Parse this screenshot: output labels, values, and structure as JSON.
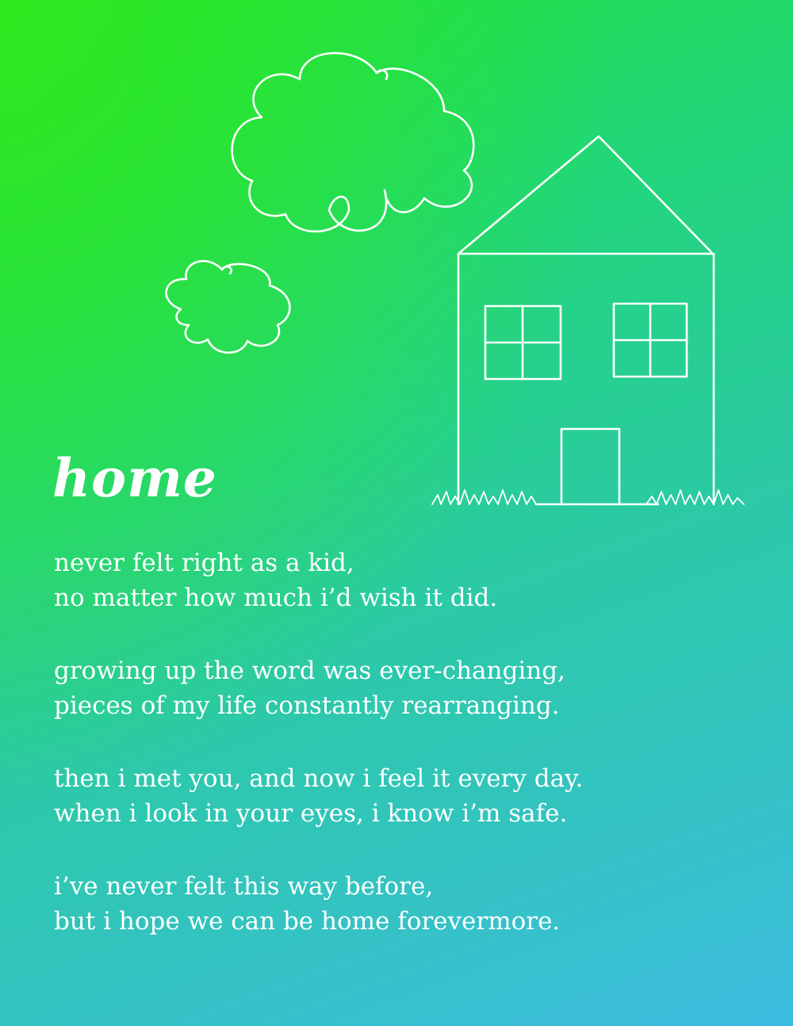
{
  "title": "home",
  "poem": {
    "stanzas": [
      {
        "lines": [
          "never felt right as a kid,",
          "no matter how much i’d wish it did."
        ]
      },
      {
        "lines": [
          "growing up the word was ever-changing,",
          "pieces of my life constantly rearranging."
        ]
      },
      {
        "lines": [
          "then i met you, and now i feel it every day.",
          "when i look in your eyes, i know i’m safe."
        ]
      },
      {
        "lines": [
          "i’ve never felt this way before,",
          "but i hope we can be home forevermore."
        ]
      }
    ]
  },
  "illustration": {
    "icons": [
      "cloud-icon",
      "house-icon",
      "grass-icon"
    ],
    "line_color": "#ffffff"
  },
  "colors": {
    "gradient_top_left": "#2ee81e",
    "gradient_middle": "#2cc9a8",
    "gradient_bottom_right": "#3cbce0",
    "text": "#ffffff"
  }
}
